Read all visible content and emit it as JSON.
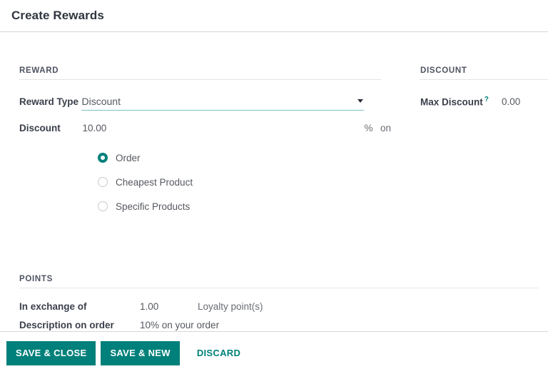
{
  "dialog": {
    "title": "Create Rewards"
  },
  "reward_section": {
    "title": "REWARD",
    "reward_type": {
      "label": "Reward Type",
      "value": "Discount",
      "caret": "chevron-down-icon"
    },
    "discount": {
      "label": "Discount",
      "value": "10.00",
      "unit": "%",
      "on_label": "on"
    },
    "applies_to_options": [
      {
        "label": "Order",
        "selected": true
      },
      {
        "label": "Cheapest Product",
        "selected": false
      },
      {
        "label": "Specific Products",
        "selected": false
      }
    ]
  },
  "discount_section": {
    "title": "DISCOUNT",
    "max_discount": {
      "label": "Max Discount",
      "help": "?",
      "value": "0.00"
    }
  },
  "points_section": {
    "title": "POINTS",
    "in_exchange_of": {
      "label": "In exchange of",
      "value": "1.00",
      "unit": "Loyalty point(s)"
    },
    "description_on_order": {
      "label": "Description on order",
      "value": "10% on your order"
    }
  },
  "footer": {
    "save_close_label": "SAVE & CLOSE",
    "save_new_label": "SAVE & NEW",
    "discard_label": "DISCARD"
  },
  "colors": {
    "accent": "#00807a",
    "underline": "#7ec1c0",
    "text": "#55585f",
    "label": "#3b3f4b",
    "divider": "#e4e4e6"
  }
}
